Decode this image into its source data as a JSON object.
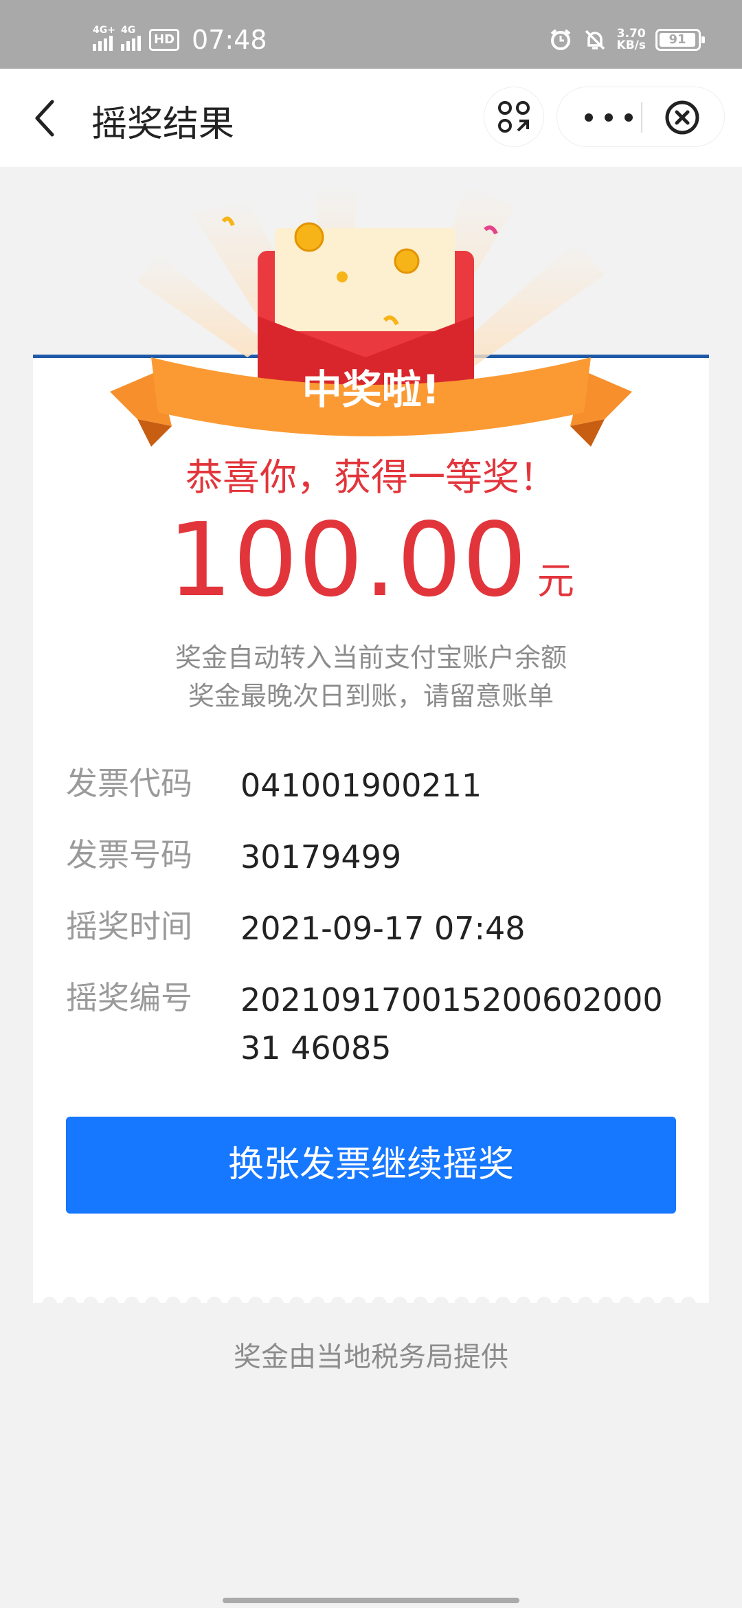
{
  "status_bar": {
    "net1": "4G+",
    "net2": "4G",
    "hd": "HD",
    "time": "07:48",
    "speed_value": "3.70",
    "speed_unit": "KB/s",
    "battery": "91"
  },
  "nav": {
    "title": "摇奖结果"
  },
  "banner": {
    "text": "中奖啦!"
  },
  "result": {
    "congrats": "恭喜你，获得一等奖！",
    "amount": "100.00",
    "unit": "元",
    "note_1": "奖金自动转入当前支付宝账户余额",
    "note_2": "奖金最晚次日到账，请留意账单"
  },
  "details": [
    {
      "label": "发票代码",
      "value": "041001900211"
    },
    {
      "label": "发票号码",
      "value": "30179499"
    },
    {
      "label": "摇奖时间",
      "value": "2021-09-17 07:48"
    },
    {
      "label": "摇奖编号",
      "value": "20210917001520060200031 46085"
    }
  ],
  "action_button": "换张发票继续摇奖",
  "footer": "奖金由当地税务局提供",
  "colors": {
    "accent_red": "#e2353b",
    "primary_blue": "#1677ff",
    "ribbon_orange": "#f7902c"
  }
}
